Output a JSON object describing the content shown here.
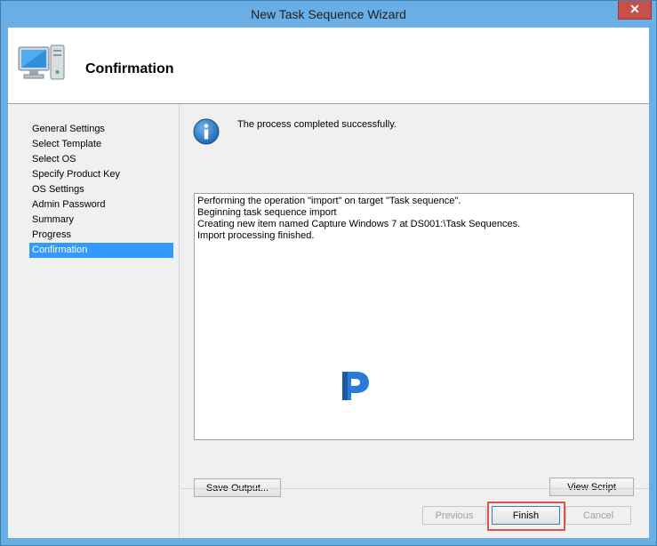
{
  "window": {
    "title": "New Task Sequence Wizard",
    "close_label": "✕"
  },
  "header": {
    "title": "Confirmation",
    "icon": "computer-icon"
  },
  "sidebar": {
    "items": [
      {
        "label": "General Settings"
      },
      {
        "label": "Select Template"
      },
      {
        "label": "Select OS"
      },
      {
        "label": "Specify Product Key"
      },
      {
        "label": "OS Settings"
      },
      {
        "label": "Admin Password"
      },
      {
        "label": "Summary"
      },
      {
        "label": "Progress"
      },
      {
        "label": "Confirmation",
        "selected": true
      }
    ]
  },
  "main": {
    "status_icon": "info-icon",
    "status_text": "The process completed successfully.",
    "output_lines": [
      "Performing the operation \"import\" on target \"Task sequence\".",
      "Beginning task sequence import",
      "Creating new item named Capture Windows 7 at DS001:\\Task Sequences.",
      "Import processing finished."
    ],
    "save_output_label": "Save Output...",
    "view_script_label": "View Script"
  },
  "footer": {
    "previous_label": "Previous",
    "finish_label": "Finish",
    "cancel_label": "Cancel"
  },
  "colors": {
    "selection": "#3399ff",
    "titlebar": "#6aaee6",
    "close": "#c7504a",
    "highlight": "#e0504a"
  }
}
